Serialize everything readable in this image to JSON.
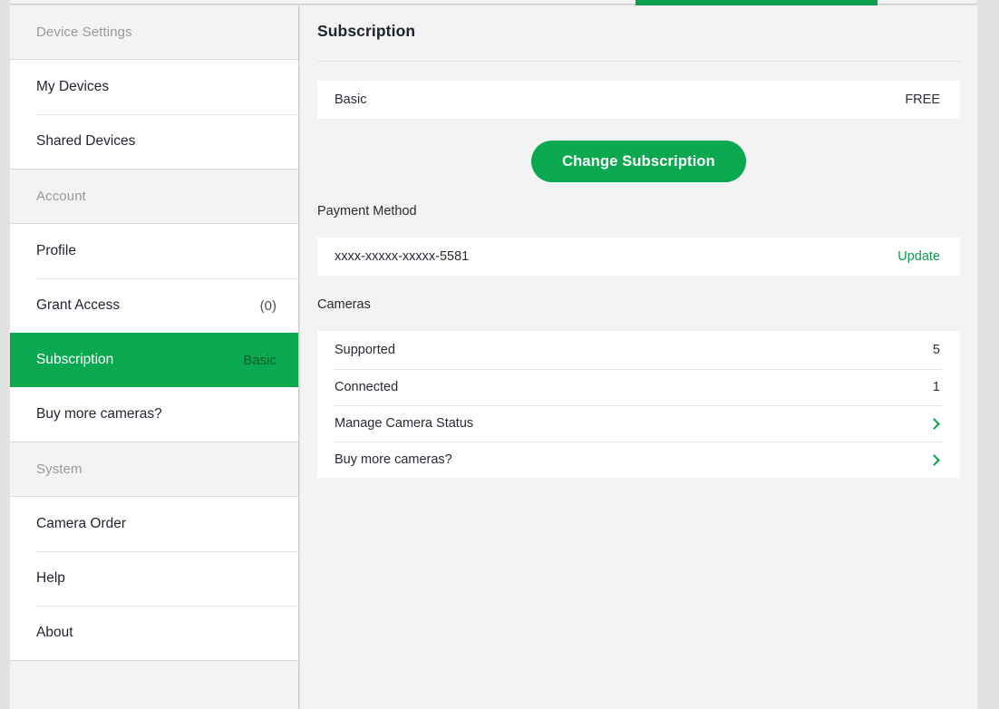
{
  "theme": {
    "accent_green": "#0aa84f",
    "link_green": "#0aa050",
    "panel_bg": "#f3f3f3",
    "card_bg": "#ffffff",
    "text": "#272b33",
    "muted": "#9a9a9a"
  },
  "sidebar": {
    "sections": [
      {
        "header": "Device Settings",
        "items": [
          {
            "label": "My Devices",
            "aux": "",
            "active": false
          },
          {
            "label": "Shared Devices",
            "aux": "",
            "active": false
          }
        ]
      },
      {
        "header": "Account",
        "items": [
          {
            "label": "Profile",
            "aux": "",
            "active": false
          },
          {
            "label": "Grant Access",
            "aux": "(0)",
            "active": false
          },
          {
            "label": "Subscription",
            "aux": "Basic",
            "active": true
          },
          {
            "label": "Buy more cameras?",
            "aux": "",
            "active": false
          }
        ]
      },
      {
        "header": "System",
        "items": [
          {
            "label": "Camera Order",
            "aux": "",
            "active": false
          },
          {
            "label": "Help",
            "aux": "",
            "active": false
          },
          {
            "label": "About",
            "aux": "",
            "active": false
          }
        ]
      }
    ]
  },
  "main": {
    "title": "Subscription",
    "plan": {
      "name": "Basic",
      "price": "FREE"
    },
    "change_subscription_button": "Change Subscription",
    "payment_method": {
      "label": "Payment Method",
      "card_number": "xxxx-xxxxx-xxxxx-5581",
      "update_link": "Update"
    },
    "cameras": {
      "label": "Cameras",
      "rows": [
        {
          "label": "Supported",
          "value": "5",
          "chevron": false
        },
        {
          "label": "Connected",
          "value": "1",
          "chevron": false
        },
        {
          "label": "Manage Camera Status",
          "value": "",
          "chevron": true
        },
        {
          "label": "Buy more cameras?",
          "value": "",
          "chevron": true
        }
      ]
    }
  }
}
